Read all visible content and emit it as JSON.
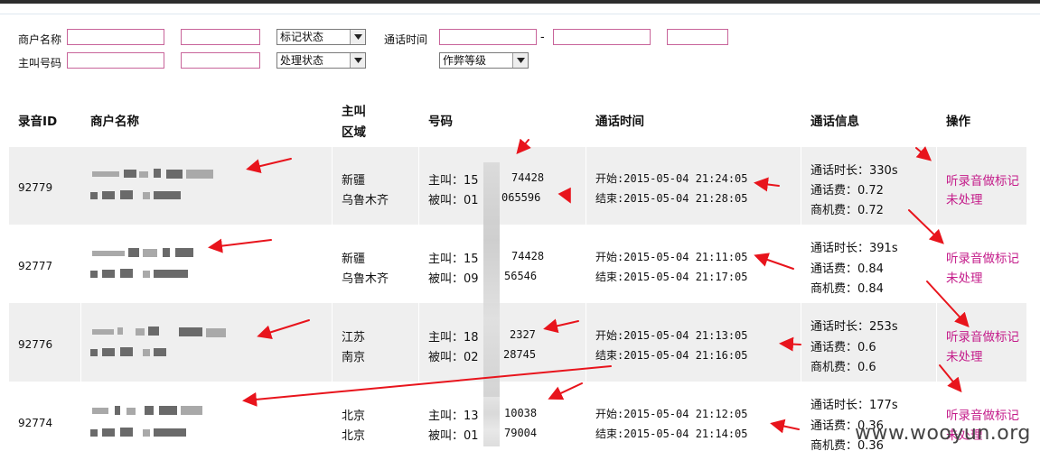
{
  "filters": {
    "merchant_name_label": "商户名称",
    "caller_label": "主叫号码",
    "mark_status": "标记状态",
    "handle_status": "处理状态",
    "call_time_label": "通话时间",
    "fraud_level": "作弊等级",
    "range_dash": "-"
  },
  "table": {
    "headers": {
      "id": "录音ID",
      "merchant": "商户名称",
      "region_line1": "主叫",
      "region_line2": "区域",
      "number": "号码",
      "time": "通话时间",
      "info": "通话信息",
      "action": "操作"
    },
    "rows": [
      {
        "id": "92779",
        "region_province": "新疆",
        "region_city": "乌鲁木齐",
        "caller": "主叫：15",
        "caller_tail": "74428",
        "callee": "被叫：01",
        "callee_tail": "065596",
        "start": "开始:2015-05-04 21:24:05",
        "end": "结束:2015-05-04 21:28:05",
        "duration": "通话时长：330s",
        "fee": "通话费：0.72",
        "merchant_fee": "商机费：0.72",
        "action": "听录音做标记",
        "status": "未处理"
      },
      {
        "id": "92777",
        "region_province": "新疆",
        "region_city": "乌鲁木齐",
        "caller": "主叫：15",
        "caller_tail": "74428",
        "callee": "被叫：09",
        "callee_tail": "56546",
        "start": "开始:2015-05-04 21:11:05",
        "end": "结束:2015-05-04 21:17:05",
        "duration": "通话时长：391s",
        "fee": "通话费：0.84",
        "merchant_fee": "商机费：0.84",
        "action": "听录音做标记",
        "status": "未处理"
      },
      {
        "id": "92776",
        "region_province": "江苏",
        "region_city": "南京",
        "caller": "主叫：18",
        "caller_tail": "2327",
        "callee": "被叫：02",
        "callee_tail": "28745",
        "start": "开始:2015-05-04 21:13:05",
        "end": "结束:2015-05-04 21:16:05",
        "duration": "通话时长：253s",
        "fee": "通话费：0.6",
        "merchant_fee": "商机费：0.6",
        "action": "听录音做标记",
        "status": "未处理"
      },
      {
        "id": "92774",
        "region_province": "北京",
        "region_city": "北京",
        "caller": "主叫：13",
        "caller_tail": "10038",
        "callee": "被叫：01",
        "callee_tail": "79004",
        "start": "开始:2015-05-04 21:12:05",
        "end": "结束:2015-05-04 21:14:05",
        "duration": "通话时长：177s",
        "fee": "通话费：0.36",
        "merchant_fee": "商机费：0.36",
        "action": "听录音做标记",
        "status": "未处理"
      }
    ]
  },
  "watermark": "www.wooyun.org",
  "colors": {
    "link": "#c41c8a",
    "input_border": "#c8649a",
    "annotation": "#e8141c",
    "row_stripe": "#efefef"
  }
}
